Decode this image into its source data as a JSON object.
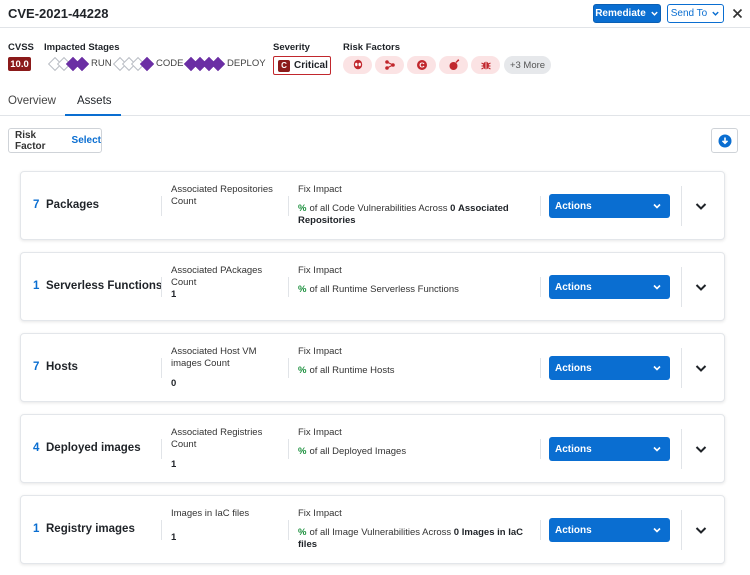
{
  "header": {
    "title": "CVE-2021-44228",
    "remediate_label": "Remediate",
    "sendto_label": "Send To"
  },
  "meta": {
    "cvss_label": "CVSS",
    "cvss_score": "10.0",
    "stages_label": "Impacted Stages",
    "stages": [
      {
        "label": "RUN",
        "filled": 2
      },
      {
        "label": "CODE",
        "filled": 1
      },
      {
        "label": "DEPLOY",
        "filled": 4
      }
    ],
    "severity_label": "Severity",
    "severity_icon": "C",
    "severity_value": "Critical",
    "risk_factors_label": "Risk Factors",
    "risk_factor_icons": [
      "alien-icon",
      "network-icon",
      "c-icon",
      "bomb-icon",
      "bug-icon"
    ],
    "risk_factors_more": "+3 More"
  },
  "tabs": [
    "Overview",
    "Assets"
  ],
  "filter": {
    "label": "Risk Factor",
    "select": "Select"
  },
  "cards": [
    {
      "count": "7",
      "name": "Packages",
      "assoc_label": "Associated Repositories Count",
      "assoc_value": "",
      "fix_label": "Fix Impact",
      "pct": "%",
      "fix_text": "of all Code Vulnerabilities Across",
      "fix_num": "0",
      "fix_suffix": "Associated Repositories",
      "actions": "Actions"
    },
    {
      "count": "1",
      "name": "Serverless Functions",
      "assoc_label": "Associated PAckages Count",
      "assoc_value": "1",
      "fix_label": "Fix Impact",
      "pct": "%",
      "fix_text": "of all Runtime Serverless Functions",
      "fix_num": "",
      "fix_suffix": "",
      "actions": "Actions"
    },
    {
      "count": "7",
      "name": "Hosts",
      "assoc_label": "Associated Host VM images Count",
      "assoc_value": "0",
      "fix_label": "Fix Impact",
      "pct": "%",
      "fix_text": "of all Runtime Hosts",
      "fix_num": "",
      "fix_suffix": "",
      "actions": "Actions"
    },
    {
      "count": "4",
      "name": "Deployed images",
      "assoc_label": "Associated Registries Count",
      "assoc_value": "1",
      "fix_label": "Fix Impact",
      "pct": "%",
      "fix_text": "of all Deployed Images",
      "fix_num": "",
      "fix_suffix": "",
      "actions": "Actions"
    },
    {
      "count": "1",
      "name": "Registry images",
      "assoc_label": "Images in IaC files",
      "assoc_value": "1",
      "fix_label": "Fix Impact",
      "pct": "%",
      "fix_text": "of all Image Vulnerabilities Across",
      "fix_num": "0",
      "fix_suffix": "Images in IaC files",
      "actions": "Actions"
    }
  ],
  "colors": {
    "accent": "#0a6ed1",
    "critical": "#8b1a1a",
    "stage": "#6b2fa4",
    "fix_pct": "#1a8f3c"
  }
}
